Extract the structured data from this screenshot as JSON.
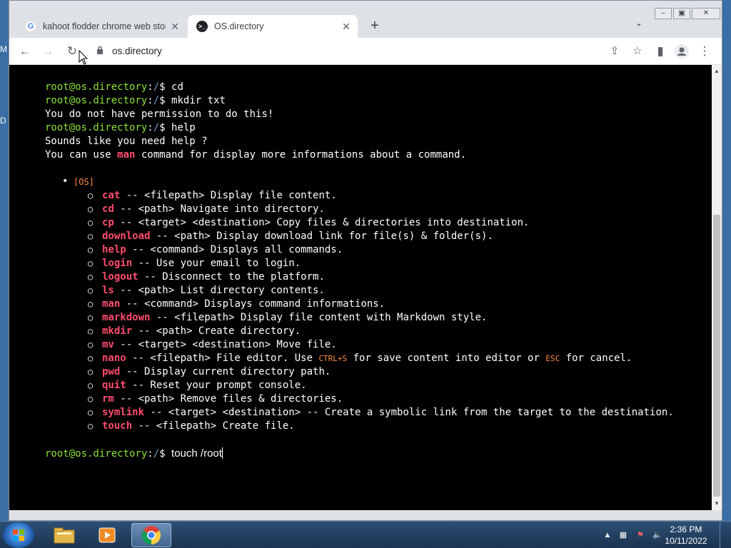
{
  "desktop": {
    "edge_letters": [
      "M",
      "D"
    ]
  },
  "browser": {
    "tabs": [
      {
        "title": "kahoot flodder chrome web store",
        "favicon": "google-icon",
        "active": false
      },
      {
        "title": "OS.directory",
        "favicon": "osdirectory-icon",
        "active": true
      }
    ],
    "url": "os.directory"
  },
  "terminal": {
    "user": "root@os.directory",
    "path": "/",
    "symbol": "$",
    "history": [
      {
        "type": "cmd",
        "text": "cd"
      },
      {
        "type": "cmd",
        "text": "mkdir txt"
      },
      {
        "type": "out",
        "text": "You do not have permission to do this!"
      },
      {
        "type": "cmd",
        "text": "help"
      },
      {
        "type": "out",
        "text": "Sounds like you need help ?"
      }
    ],
    "help_line": {
      "before": "You can use ",
      "highlight": "man",
      "after": " command for display more informations about a command."
    },
    "group_label": "[OS]",
    "commands": [
      {
        "name": "cat",
        "desc": " -- <filepath> Display file content."
      },
      {
        "name": "cd",
        "desc": " -- <path> Navigate into directory."
      },
      {
        "name": "cp",
        "desc": " -- <target> <destination> Copy files & directories into destination."
      },
      {
        "name": "download",
        "desc": " -- <path> Display download link for file(s) & folder(s)."
      },
      {
        "name": "help",
        "desc": " -- <command> Displays all commands."
      },
      {
        "name": "login",
        "desc": " -- Use your email to login."
      },
      {
        "name": "logout",
        "desc": " -- Disconnect to the platform."
      },
      {
        "name": "ls",
        "desc": " -- <path> List directory contents."
      },
      {
        "name": "man",
        "desc": " -- <command> Displays command informations."
      },
      {
        "name": "markdown",
        "desc": " -- <filepath> Display file content with Markdown style."
      },
      {
        "name": "mkdir",
        "desc": " -- <path> Create directory."
      },
      {
        "name": "mv",
        "desc": " -- <target> <destination> Move file."
      },
      {
        "name": "nano",
        "desc": " -- <filepath> File editor. Use ",
        "key1": "CTRL+S",
        "mid": " for save content into editor or ",
        "key2": "ESC",
        "end": " for cancel."
      },
      {
        "name": "pwd",
        "desc": " -- Display current directory path."
      },
      {
        "name": "quit",
        "desc": " -- Reset your prompt console."
      },
      {
        "name": "rm",
        "desc": " -- <path> Remove files & directories."
      },
      {
        "name": "symlink",
        "desc": " -- <target> <destination> -- Create a symbolic link from the target to the destination."
      },
      {
        "name": "touch",
        "desc": " -- <filepath> Create file."
      }
    ],
    "current_input": "touch /root"
  },
  "taskbar": {
    "apps": [
      "file-explorer-icon",
      "media-player-icon",
      "chrome-icon"
    ],
    "time": "2:36 PM",
    "date": "10/11/2022"
  },
  "colors": {
    "prompt": "#8ae234",
    "path": "#729fcf",
    "command": "#ff4d6d",
    "key": "#ff8c42"
  }
}
